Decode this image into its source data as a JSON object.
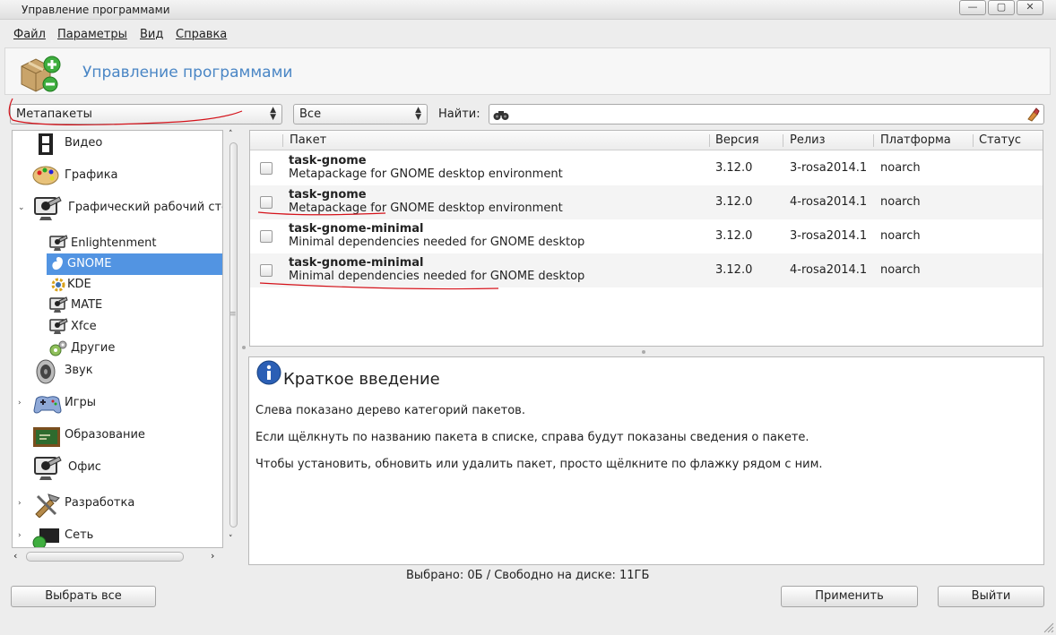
{
  "window": {
    "title": "Управление программами",
    "controls": [
      "minimize-icon",
      "maximize-icon",
      "close-icon"
    ]
  },
  "menu": {
    "items": [
      {
        "label": "Файл"
      },
      {
        "label": "Параметры"
      },
      {
        "label": "Вид"
      },
      {
        "label": "Справка"
      }
    ]
  },
  "banner": {
    "title": "Управление программами",
    "icon": "package-add-remove-icon"
  },
  "filters": {
    "type_combo": "Метапакеты",
    "status_combo": "Все",
    "search_label": "Найти:",
    "search_value": ""
  },
  "categories": [
    {
      "label": "Видео",
      "icon": "film-strip-icon"
    },
    {
      "label": "Графика",
      "icon": "palette-icon"
    },
    {
      "label": "Графический рабочий стол",
      "icon": "desktop-icon",
      "expanded": true
    },
    {
      "label": "Enlightenment",
      "icon": "desktop-icon"
    },
    {
      "label": "GNOME",
      "icon": "gnome-icon",
      "selected": true
    },
    {
      "label": "KDE",
      "icon": "kde-gear-icon"
    },
    {
      "label": "MATE",
      "icon": "desktop-icon"
    },
    {
      "label": "Xfce",
      "icon": "desktop-icon"
    },
    {
      "label": "Другие",
      "icon": "gears-icon"
    },
    {
      "label": "Звук",
      "icon": "speaker-icon"
    },
    {
      "label": "Игры",
      "icon": "gamepad-icon"
    },
    {
      "label": "Образование",
      "icon": "chalkboard-icon"
    },
    {
      "label": "Офис",
      "icon": "desktop-icon"
    },
    {
      "label": "Разработка",
      "icon": "tools-icon"
    },
    {
      "label": "Сеть",
      "icon": "network-icon"
    }
  ],
  "table": {
    "columns": [
      "Пакет",
      "Версия",
      "Релиз",
      "Платформа",
      "Статус"
    ],
    "rows": [
      {
        "name": "task-gnome",
        "description": "Metapackage for GNOME desktop environment",
        "version": "3.12.0",
        "release": "3-rosa2014.1",
        "platform": "noarch",
        "status": ""
      },
      {
        "name": "task-gnome",
        "description": "Metapackage for GNOME desktop environment",
        "version": "3.12.0",
        "release": "4-rosa2014.1",
        "platform": "noarch",
        "status": ""
      },
      {
        "name": "task-gnome-minimal",
        "description": "Minimal dependencies needed for GNOME desktop",
        "version": "3.12.0",
        "release": "3-rosa2014.1",
        "platform": "noarch",
        "status": ""
      },
      {
        "name": "task-gnome-minimal",
        "description": "Minimal dependencies needed for GNOME desktop",
        "version": "3.12.0",
        "release": "4-rosa2014.1",
        "platform": "noarch",
        "status": ""
      }
    ]
  },
  "info": {
    "icon": "info-icon",
    "title": "Краткое введение",
    "paragraphs": [
      "Слева показано дерево категорий пакетов.",
      "Если щёлкнуть по названию пакета в списке, справа будут показаны сведения о пакете.",
      "Чтобы установить, обновить или удалить пакет, просто щёлкните по флажку рядом с ним."
    ]
  },
  "status": "Выбрано: 0Б / Свободно на диске: 11ГБ",
  "buttons": {
    "select_all": "Выбрать все",
    "apply": "Применить",
    "quit": "Выйти"
  },
  "colors": {
    "accent": "#5294e2",
    "banner_title": "#4a86c5",
    "annotation": "#d4121a"
  }
}
